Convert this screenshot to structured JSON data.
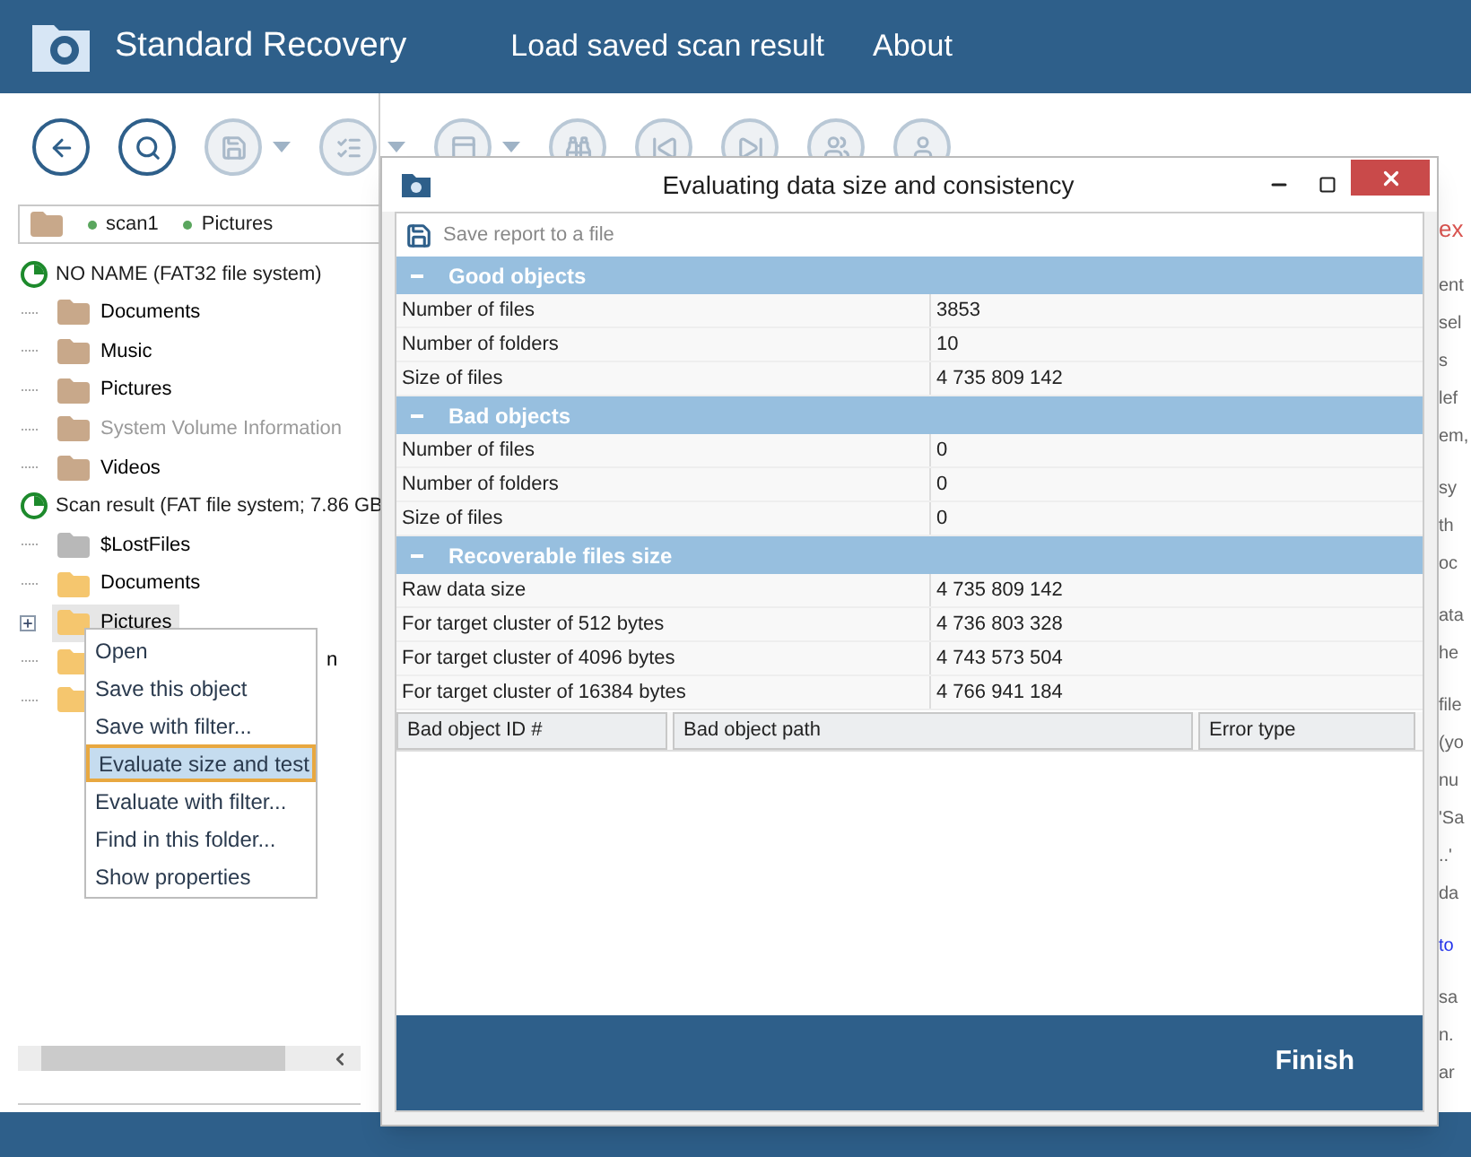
{
  "app": {
    "title": "Standard Recovery",
    "menu": [
      "Load saved scan result",
      "About"
    ]
  },
  "toolbar": [
    {
      "kind": "back",
      "disabled": false,
      "caret": false
    },
    {
      "kind": "search",
      "disabled": false,
      "caret": false
    },
    {
      "kind": "save",
      "disabled": true,
      "caret": true
    },
    {
      "kind": "checklist",
      "disabled": true,
      "caret": true
    },
    {
      "kind": "window",
      "disabled": true,
      "caret": true
    },
    {
      "kind": "binoculars",
      "disabled": true,
      "caret": false
    },
    {
      "kind": "prev",
      "disabled": true,
      "caret": false
    },
    {
      "kind": "next",
      "disabled": true,
      "caret": false
    },
    {
      "kind": "users",
      "disabled": true,
      "caret": false
    },
    {
      "kind": "user",
      "disabled": true,
      "caret": false
    }
  ],
  "path": [
    "scan1",
    "Pictures"
  ],
  "tree": [
    {
      "kind": "drive",
      "label": "NO NAME (FAT32 file system)",
      "children": [
        {
          "kind": "folder",
          "color": "#c8a88a",
          "label": "Documents",
          "dimmed": false,
          "selected": false,
          "expandable": false
        },
        {
          "kind": "folder",
          "color": "#c8a88a",
          "label": "Music",
          "dimmed": false,
          "selected": false,
          "expandable": false
        },
        {
          "kind": "folder",
          "color": "#c8a88a",
          "label": "Pictures",
          "dimmed": false,
          "selected": false,
          "expandable": false
        },
        {
          "kind": "folder",
          "color": "#c8a88a",
          "label": "System Volume Information",
          "dimmed": true,
          "selected": false,
          "expandable": false
        },
        {
          "kind": "folder",
          "color": "#c8a88a",
          "label": "Videos",
          "dimmed": false,
          "selected": false,
          "expandable": false
        }
      ]
    },
    {
      "kind": "drive",
      "label": "Scan result (FAT file system; 7.86 GB",
      "children": [
        {
          "kind": "folder",
          "color": "#b8b8b8",
          "label": "$LostFiles",
          "dimmed": false,
          "selected": false,
          "expandable": false
        },
        {
          "kind": "folder",
          "color": "#f5c66e",
          "label": "Documents",
          "dimmed": false,
          "selected": false,
          "expandable": false
        },
        {
          "kind": "folder",
          "color": "#f5c66e",
          "label": "Pictures",
          "dimmed": false,
          "selected": true,
          "expandable": true
        },
        {
          "kind": "folder",
          "color": "#f5c66e",
          "label": "n",
          "dimmed": false,
          "selected": false,
          "expandable": false
        },
        {
          "kind": "folder",
          "color": "#f5c66e",
          "selected": false,
          "expandable": false
        }
      ]
    }
  ],
  "context_menu": [
    {
      "label": "Open",
      "selected": false
    },
    {
      "label": "Save this object",
      "selected": false
    },
    {
      "label": "Save with filter...",
      "selected": false
    },
    {
      "label": "Evaluate size and test",
      "selected": true
    },
    {
      "label": "Evaluate with filter...",
      "selected": false
    },
    {
      "label": "Find in this folder...",
      "selected": false
    },
    {
      "label": "Show properties",
      "selected": false
    }
  ],
  "background_text": [
    [
      {
        "text": "ex",
        "kind": "heading"
      }
    ],
    [
      {
        "text": "ent",
        "kind": "plain"
      },
      {
        "text": "sel",
        "kind": "plain"
      },
      {
        "text": "s",
        "kind": "plain"
      },
      {
        "text": "lef",
        "kind": "plain"
      },
      {
        "text": "em,",
        "kind": "plain"
      }
    ],
    [
      {
        "text": "sy",
        "kind": "plain"
      },
      {
        "text": "th",
        "kind": "plain"
      },
      {
        "text": "oc",
        "kind": "plain"
      }
    ],
    [
      {
        "text": "ata",
        "kind": "plain"
      },
      {
        "text": "he",
        "kind": "plain"
      }
    ],
    [
      {
        "text": "file",
        "kind": "plain"
      },
      {
        "text": "(yo",
        "kind": "plain"
      },
      {
        "text": "nu",
        "kind": "plain"
      },
      {
        "text": "'Sa",
        "kind": "plain"
      },
      {
        "text": "..'",
        "kind": "plain"
      },
      {
        "text": "da",
        "kind": "plain"
      }
    ],
    [
      {
        "text": "to",
        "kind": "link"
      }
    ],
    [
      {
        "text": "sa",
        "kind": "plain"
      },
      {
        "text": "n.",
        "kind": "plain"
      },
      {
        "text": "ar",
        "kind": "plain"
      }
    ]
  ],
  "dialog": {
    "title": "Evaluating data size and consistency",
    "save_report": "Save report to a file",
    "sections": [
      {
        "title": "Good objects",
        "expanded": true,
        "rows": [
          [
            "Number of files",
            "3853"
          ],
          [
            "Number of folders",
            "10"
          ],
          [
            "Size of files",
            "4 735 809 142"
          ]
        ]
      },
      {
        "title": "Bad objects",
        "expanded": true,
        "rows": [
          [
            "Number of files",
            "0"
          ],
          [
            "Number of folders",
            "0"
          ],
          [
            "Size of files",
            "0"
          ]
        ]
      },
      {
        "title": "Recoverable files size",
        "expanded": true,
        "rows": [
          [
            "Raw data size",
            "4 735 809 142"
          ],
          [
            "For target cluster of 512 bytes",
            "4 736 803 328"
          ],
          [
            "For target cluster of 4096 bytes",
            "4 743 573 504"
          ],
          [
            "For target cluster of 16384 bytes",
            "4 766 941 184"
          ]
        ]
      }
    ],
    "columns": [
      "Bad object ID #",
      "Bad object path",
      "Error type"
    ],
    "finish": "Finish"
  }
}
